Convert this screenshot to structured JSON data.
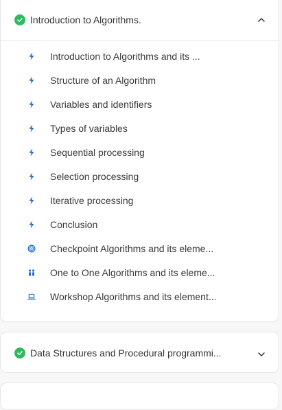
{
  "colors": {
    "accent": "#1a6fe0",
    "check": "#2dbb5d",
    "text": "#3a3a3c",
    "border": "#e6e6e9"
  },
  "modules": [
    {
      "title": "Introduction to Algorithms.",
      "status_icon": "check-circle-icon",
      "expanded": true,
      "toggle_icon": "chevron-up-icon",
      "lessons": [
        {
          "label": "Introduction to Algorithms and its ...",
          "icon": "lightning-icon"
        },
        {
          "label": "Structure of an Algorithm",
          "icon": "lightning-icon"
        },
        {
          "label": "Variables and identifiers",
          "icon": "lightning-icon"
        },
        {
          "label": "Types of variables",
          "icon": "lightning-icon"
        },
        {
          "label": "Sequential processing",
          "icon": "lightning-icon"
        },
        {
          "label": "Selection processing",
          "icon": "lightning-icon"
        },
        {
          "label": "Iterative processing",
          "icon": "lightning-icon"
        },
        {
          "label": "Conclusion",
          "icon": "lightning-icon"
        },
        {
          "label": "Checkpoint Algorithms and its eleme...",
          "icon": "target-icon"
        },
        {
          "label": "One to One Algorithms and its eleme...",
          "icon": "people-icon"
        },
        {
          "label": "Workshop Algorithms and its element...",
          "icon": "laptop-icon"
        }
      ]
    },
    {
      "title": "Data Structures and Procedural programmi...",
      "status_icon": "check-circle-icon",
      "expanded": false,
      "toggle_icon": "chevron-down-icon"
    }
  ]
}
